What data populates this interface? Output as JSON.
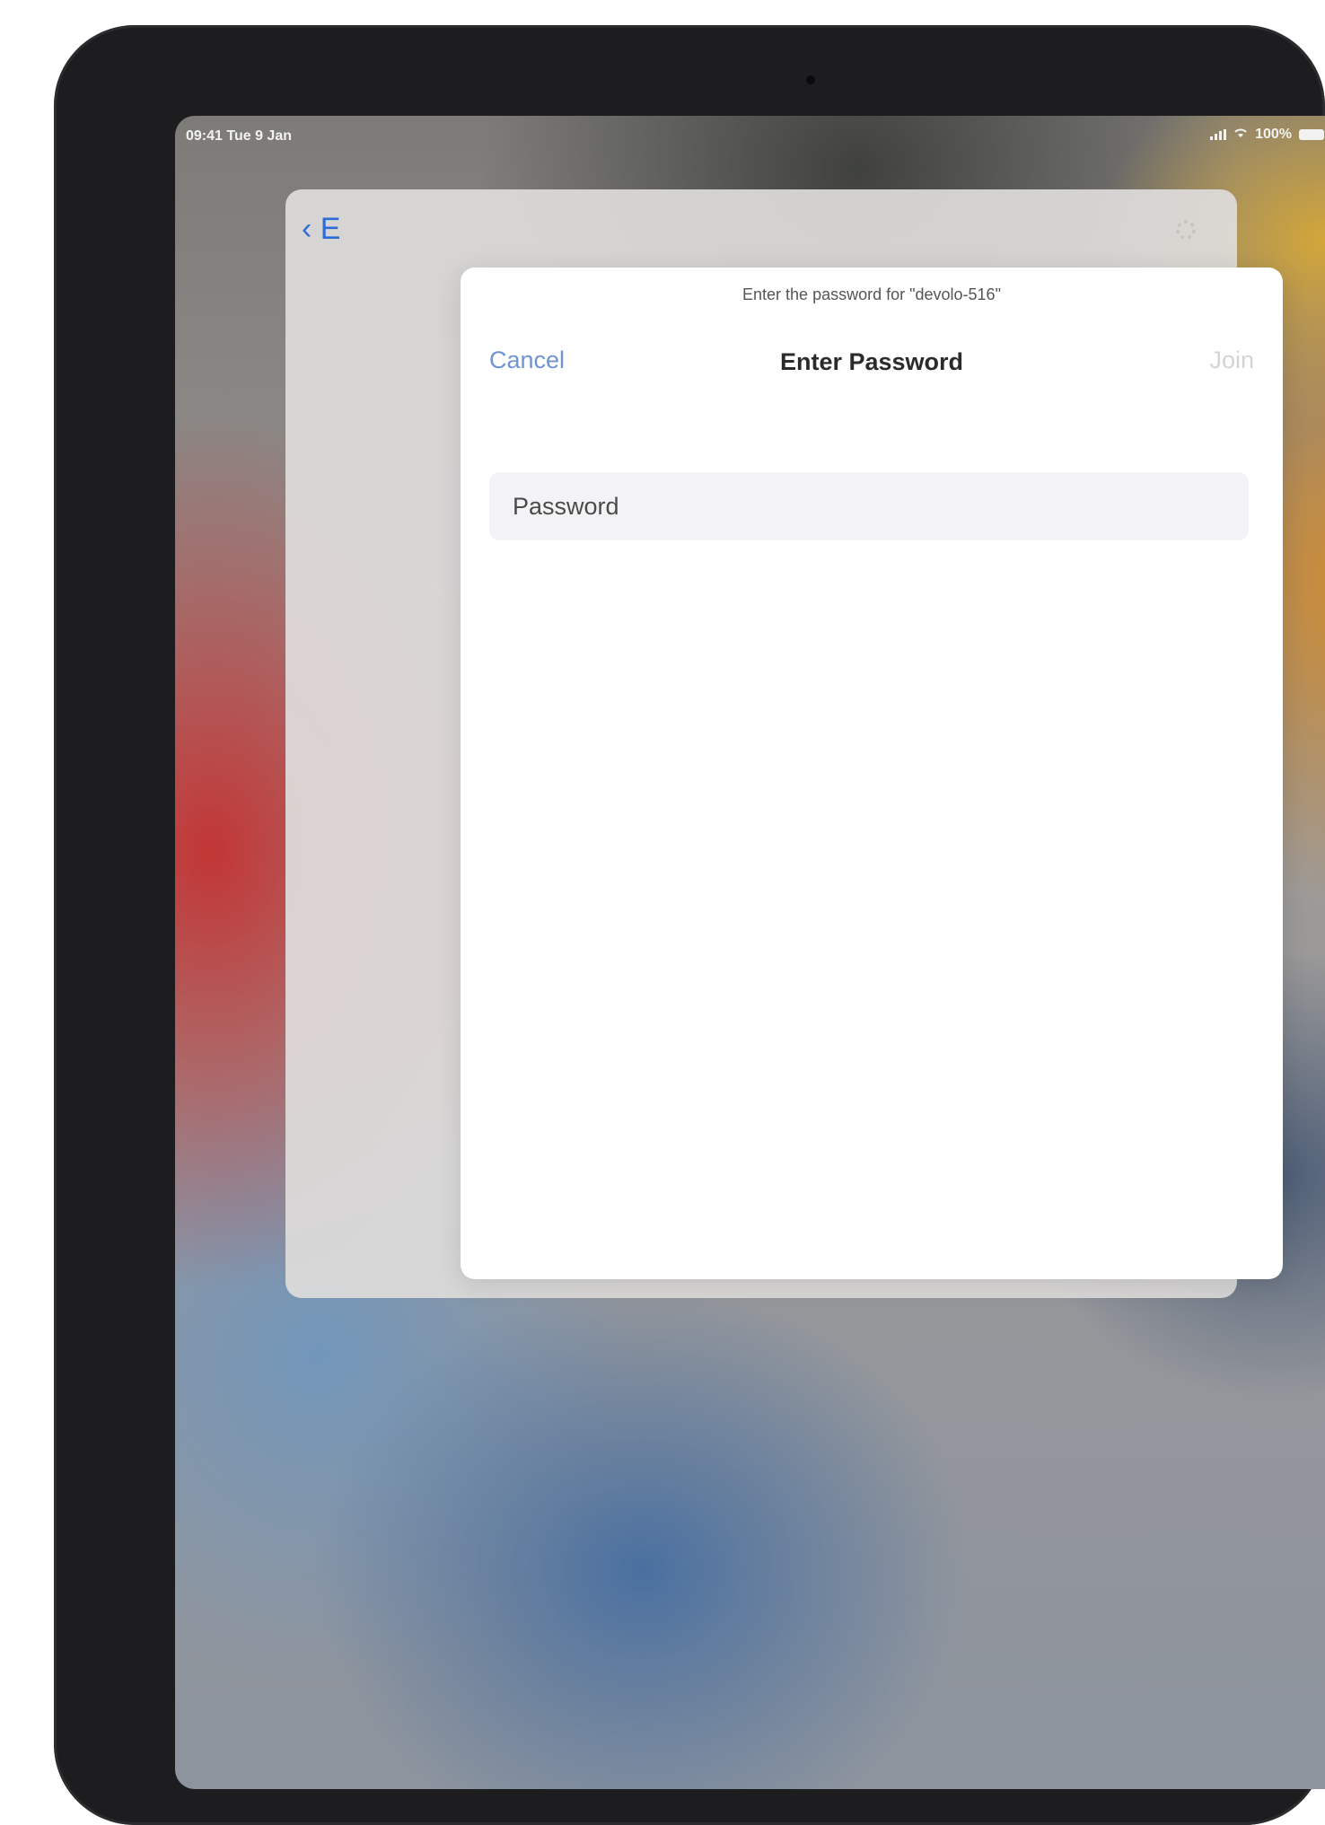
{
  "status_bar": {
    "time_date": "09:41 Tue 9 Jan",
    "battery_text": "100%",
    "signal_icon": "cellular-signal-icon",
    "wifi_icon": "wifi-icon",
    "battery_icon": "battery-icon"
  },
  "background_sheet": {
    "back_label": "‹ E",
    "settings_icon": "gear-icon"
  },
  "dialog": {
    "prompt": "Enter the password for \"devolo-516\"",
    "cancel_label": "Cancel",
    "title": "Enter Password",
    "join_label": "Join",
    "password_field": {
      "placeholder": "Password",
      "value": ""
    }
  },
  "colors": {
    "accent": "#6f95cf",
    "join_disabled": "#d4d4d4"
  }
}
